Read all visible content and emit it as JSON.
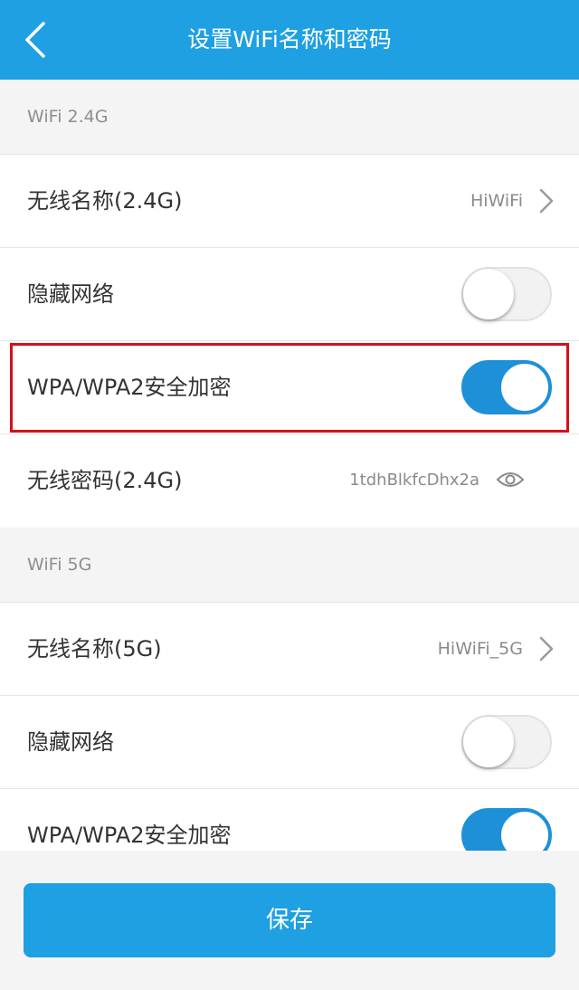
{
  "header": {
    "title": "设置WiFi名称和密码"
  },
  "sections": [
    {
      "label": "WiFi 2.4G",
      "rows": {
        "name_label": "无线名称(2.4G)",
        "name_value": "HiWiFi",
        "hide_label": "隐藏网络",
        "hide_on": false,
        "wpa_label": "WPA/WPA2安全加密",
        "wpa_on": true,
        "pwd_label": "无线密码(2.4G)",
        "pwd_value": "1tdhBlkfcDhx2a"
      }
    },
    {
      "label": "WiFi 5G",
      "rows": {
        "name_label": "无线名称(5G)",
        "name_value": "HiWiFi_5G",
        "hide_label": "隐藏网络",
        "hide_on": false,
        "wpa_label": "WPA/WPA2安全加密",
        "wpa_on": true
      }
    }
  ],
  "footer": {
    "save_label": "保存"
  },
  "colors": {
    "accent": "#1ea0e3",
    "toggle_on": "#1e90d8",
    "highlight": "#d6101c"
  },
  "icons": {
    "back": "chevron-left-icon",
    "forward": "chevron-right-icon",
    "password": "eye-icon"
  }
}
